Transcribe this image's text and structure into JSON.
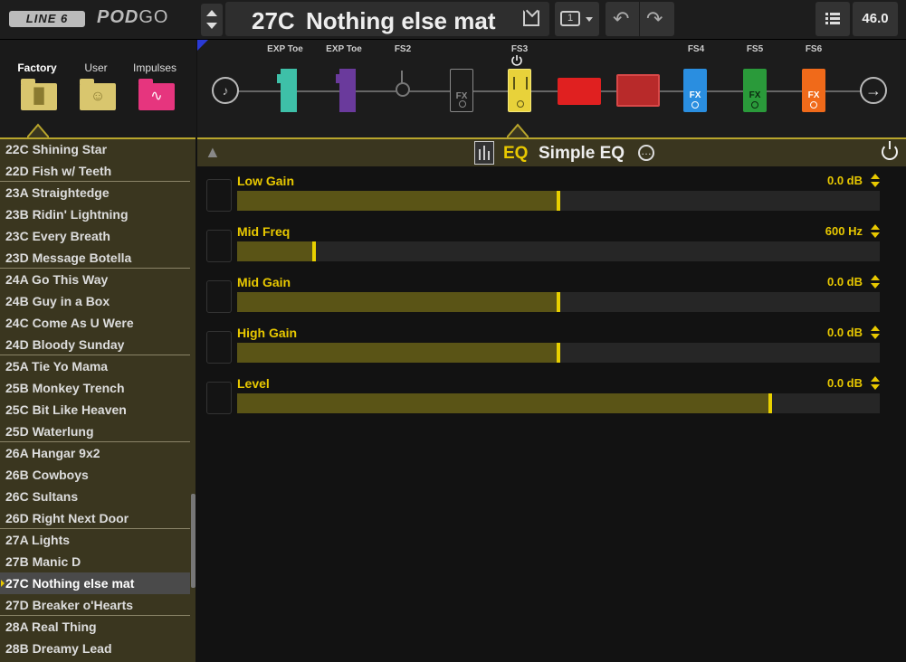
{
  "app": {
    "logo_brand": "LINE 6",
    "logo_product_bold": "POD",
    "logo_product_light": "GO"
  },
  "header": {
    "preset_number": "27C",
    "preset_name": "Nothing else mat",
    "tempo": "46.0"
  },
  "library_tabs": [
    {
      "label": "Factory",
      "active": true,
      "color": "#d9c66e",
      "icon": "factory-folder-icon"
    },
    {
      "label": "User",
      "active": false,
      "color": "#d9c66e",
      "icon": "user-folder-icon"
    },
    {
      "label": "Impulses",
      "active": false,
      "color": "#e6357e",
      "icon": "impulse-folder-icon"
    }
  ],
  "presets": [
    {
      "label": "22C Shining Star"
    },
    {
      "label": "22D Fish w/ Teeth"
    },
    {
      "label": "23A Straightedge"
    },
    {
      "label": "23B Ridin' Lightning"
    },
    {
      "label": "23C Every Breath"
    },
    {
      "label": "23D Message Botella"
    },
    {
      "label": "24A Go This Way"
    },
    {
      "label": "24B Guy in a Box"
    },
    {
      "label": "24C Come As U Were"
    },
    {
      "label": "24D Bloody Sunday"
    },
    {
      "label": "25A Tie Yo Mama"
    },
    {
      "label": "25B Monkey Trench"
    },
    {
      "label": "25C Bit Like Heaven"
    },
    {
      "label": "25D Waterlung"
    },
    {
      "label": "26A Hangar 9x2"
    },
    {
      "label": "26B Cowboys"
    },
    {
      "label": "26C Sultans"
    },
    {
      "label": "26D Right Next Door"
    },
    {
      "label": "27A Lights"
    },
    {
      "label": "27B Manic D"
    },
    {
      "label": "27C Nothing else mat",
      "selected": true
    },
    {
      "label": "27D Breaker o'Hearts"
    },
    {
      "label": "28A Real Thing"
    },
    {
      "label": "28B Dreamy Lead"
    }
  ],
  "chain": {
    "labels": {
      "exp_toe_1": "EXP Toe",
      "exp_toe_2": "EXP Toe",
      "fs2": "FS2",
      "fs3": "FS3",
      "fs4": "FS4",
      "fs5": "FS5",
      "fs6": "FS6"
    },
    "fx_label": "FX",
    "colors": {
      "wah": "#3ec0a8",
      "volume": "#6a3a9c",
      "eq": "#e8d23a",
      "amp": "#e02020",
      "cab": "#b82a2a",
      "fx_blue": "#2a8ee0",
      "fx_green": "#2a9a3a",
      "fx_orange": "#f06a1a"
    }
  },
  "editor": {
    "category": "EQ",
    "block_name": "Simple EQ",
    "params": [
      {
        "name": "Low Gain",
        "value": "0.0 dB",
        "level": 0.5
      },
      {
        "name": "Mid Freq",
        "value": "600 Hz",
        "level": 0.12
      },
      {
        "name": "Mid Gain",
        "value": "0.0 dB",
        "level": 0.5
      },
      {
        "name": "High Gain",
        "value": "0.0 dB",
        "level": 0.5
      },
      {
        "name": "Level",
        "value": "0.0 dB",
        "level": 0.83
      }
    ]
  }
}
